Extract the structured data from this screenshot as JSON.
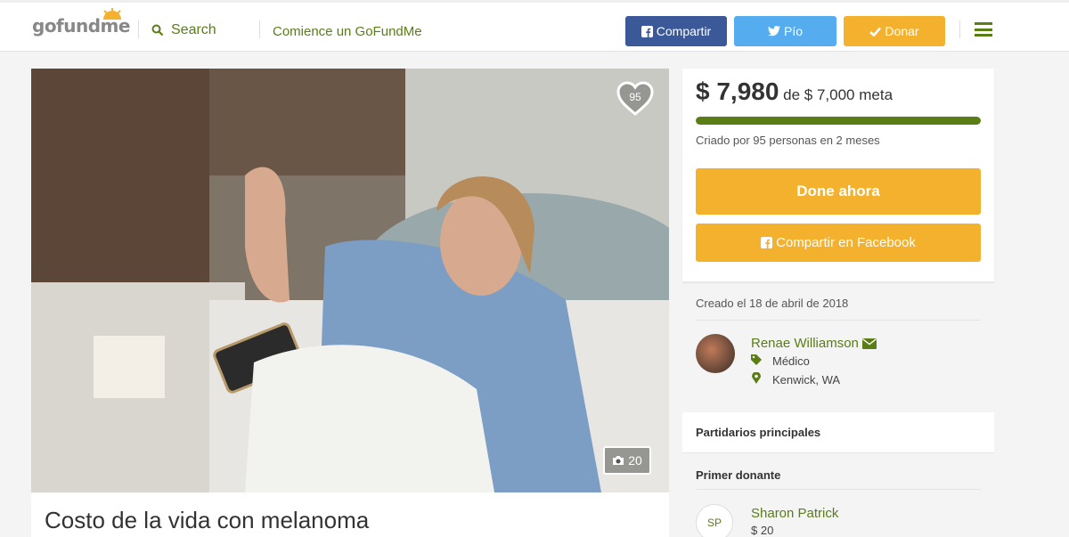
{
  "header": {
    "logo_text": "gofundme",
    "search_label": "Search",
    "start_link": "Comience un GoFundMe",
    "share_fb_label": "Compartir",
    "tweet_label": "Pío",
    "donate_label": "Donar",
    "icons": {
      "search": "search-icon",
      "facebook": "facebook-icon",
      "twitter": "twitter-icon",
      "donate": "checkmark-icon",
      "menu": "hamburger-menu-icon"
    },
    "colors": {
      "brand_green": "#5a7d16",
      "facebook": "#3b5998",
      "twitter": "#55acee",
      "donate": "#f4b12d"
    }
  },
  "campaign": {
    "heart_count": "95",
    "photo_count": "20",
    "title": "Costo de la vida con melanoma"
  },
  "funding": {
    "raised": "$ 7,980",
    "goal_text": "de $ 7,000 meta",
    "progress_fraction": 1.0,
    "created_by": "Criado por 95 personas en 2 meses",
    "donate_now": "Done ahora",
    "share_facebook": "Compartir en Facebook"
  },
  "organizer": {
    "created_date": "Creado el 18 de abril de 2018",
    "name": "Renae Williamson",
    "category": "Médico",
    "location": "Kenwick, WA"
  },
  "supporters": {
    "top_label": "Partidarios principales",
    "first_donor_label": "Primer donante",
    "donor_initials": "SP",
    "donor_name": "Sharon Patrick",
    "donor_amount": "$ 20"
  }
}
